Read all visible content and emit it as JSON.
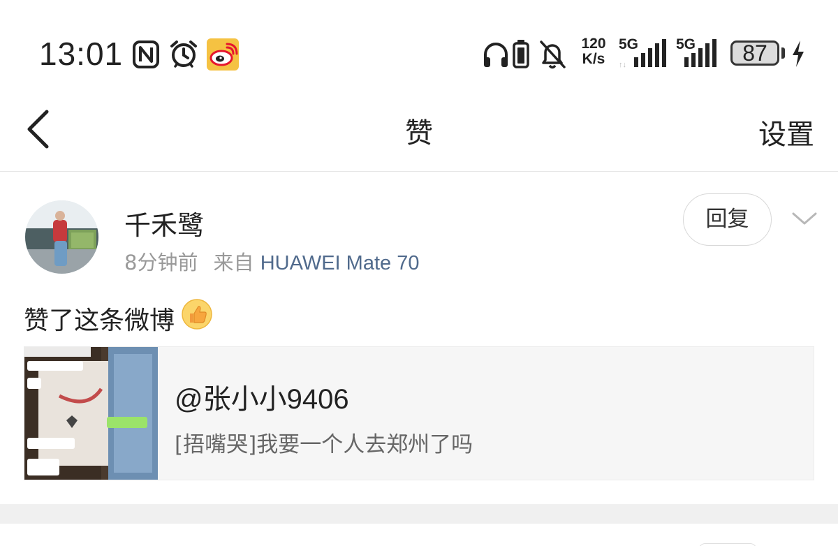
{
  "status_bar": {
    "time": "13:01",
    "icons": [
      "nfc-icon",
      "alarm-icon",
      "weibo-app-icon",
      "headphones-icon",
      "battery-saver-icon",
      "mute-icon",
      "5g-signal-icon",
      "5g-signal-icon"
    ],
    "speed_value": "120",
    "speed_unit": "K/s",
    "network_1": "5G",
    "network_2": "5G",
    "battery_level": "87"
  },
  "nav": {
    "title": "赞",
    "settings_label": "设置",
    "back_icon": "chevron-left-icon"
  },
  "post": {
    "username": "千禾鹭",
    "time": "8分钟前",
    "source_prefix": "来自",
    "device": "HUAWEI Mate 70",
    "reply_label": "回复",
    "action_text": "赞了这条微博",
    "emoji": "thumbs-up-icon",
    "quote": {
      "author": "@张小小9406",
      "text": "[捂嘴哭]我要一个人去郑州了吗"
    }
  },
  "colors": {
    "link_blue": "#506a8c",
    "muted_gray": "#999999",
    "card_bg": "#f6f6f6",
    "weibo_red": "#e6162d",
    "weibo_yellow": "#f5c242"
  }
}
